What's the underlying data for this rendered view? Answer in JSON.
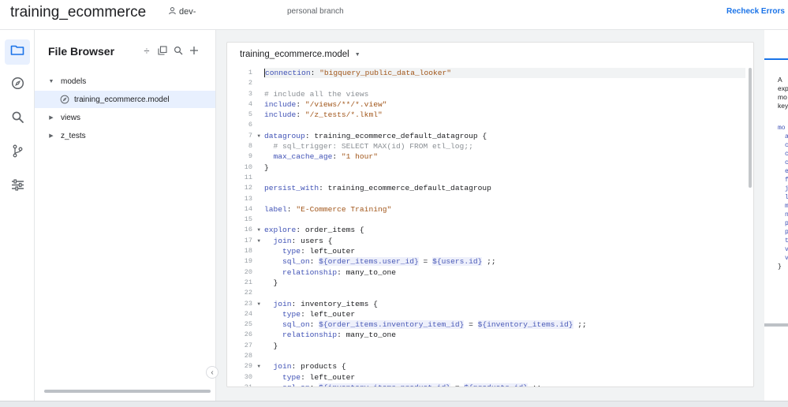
{
  "header": {
    "project_title": "training_ecommerce",
    "user": "dev-",
    "branch": "personal branch",
    "recheck_label": "Recheck Errors"
  },
  "rail": {
    "items": [
      {
        "name": "file-browser",
        "icon": "folder-icon",
        "active": true
      },
      {
        "name": "object-browser",
        "icon": "compass-icon"
      },
      {
        "name": "search",
        "icon": "search-icon"
      },
      {
        "name": "git",
        "icon": "git-branch-icon"
      },
      {
        "name": "settings",
        "icon": "sliders-icon"
      }
    ]
  },
  "file_browser": {
    "title": "File Browser",
    "tools": [
      "sort-icon",
      "copy-icon",
      "search-icon",
      "add-icon"
    ],
    "tree": [
      {
        "label": "models",
        "expanded": true
      },
      {
        "label": "training_ecommerce.model",
        "selected": true
      },
      {
        "label": "views",
        "expanded": false
      },
      {
        "label": "z_tests",
        "expanded": false
      }
    ]
  },
  "editor": {
    "file_name": "training_ecommerce.model",
    "line_numbers": [
      "1",
      "2",
      "3",
      "4",
      "5",
      "6",
      "7",
      "8",
      "9",
      "10",
      "11",
      "12",
      "13",
      "14",
      "15",
      "16",
      "17",
      "18",
      "19",
      "20",
      "21",
      "22",
      "23",
      "24",
      "25",
      "26",
      "27",
      "28",
      "29",
      "30",
      "31"
    ],
    "lines": [
      "connection: \"bigquery_public_data_looker\"",
      "",
      "# include all the views",
      "include: \"/views/**/*.view\"",
      "include: \"/z_tests/*.lkml\"",
      "",
      "datagroup: training_ecommerce_default_datagroup {",
      "  # sql_trigger: SELECT MAX(id) FROM etl_log;;",
      "  max_cache_age: \"1 hour\"",
      "}",
      "",
      "persist_with: training_ecommerce_default_datagroup",
      "",
      "label: \"E-Commerce Training\"",
      "",
      "explore: order_items {",
      "  join: users {",
      "    type: left_outer",
      "    sql_on: ${order_items.user_id} = ${users.id} ;;",
      "    relationship: many_to_one",
      "  }",
      "",
      "  join: inventory_items {",
      "    type: left_outer",
      "    sql_on: ${order_items.inventory_item_id} = ${inventory_items.id} ;;",
      "    relationship: many_to_one",
      "  }",
      "",
      "  join: products {",
      "    type: left_outer",
      "    sql_on: ${inventory_items.product_id} = ${products.id} ;;"
    ]
  },
  "right_pane": {
    "text_lines": [
      "A",
      "exp",
      "mo",
      "key"
    ],
    "code_lines": [
      "mo",
      "a",
      "c",
      "c",
      "c",
      "e",
      "f",
      "j",
      "l",
      "m",
      "n",
      "p",
      "p",
      "t",
      "v",
      "v",
      "}"
    ]
  }
}
